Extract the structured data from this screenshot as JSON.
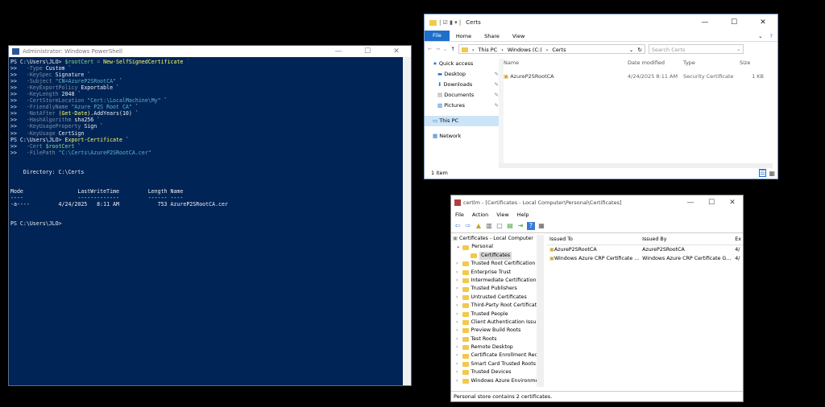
{
  "powershell": {
    "title": "Administrator: Windows PowerShell",
    "lines": [
      [
        {
          "t": "PS C:\\Users\\JLO> ",
          "c": "w"
        },
        {
          "t": "$rootCert",
          "c": "gr"
        },
        {
          "t": " = ",
          "c": "g"
        },
        {
          "t": "New-SelfSignedCertificate",
          "c": "y"
        },
        {
          "t": " `",
          "c": "g"
        }
      ],
      [
        {
          "t": ">>   ",
          "c": "w"
        },
        {
          "t": "-Type",
          "c": "g"
        },
        {
          "t": " Custom `",
          "c": "w"
        }
      ],
      [
        {
          "t": ">>   ",
          "c": "w"
        },
        {
          "t": "-KeySpec",
          "c": "g"
        },
        {
          "t": " Signature `",
          "c": "w"
        }
      ],
      [
        {
          "t": ">>   ",
          "c": "w"
        },
        {
          "t": "-Subject",
          "c": "g"
        },
        {
          "t": " \"CN=AzureP2SRootCA\"",
          "c": "c"
        },
        {
          "t": " `",
          "c": "w"
        }
      ],
      [
        {
          "t": ">>   ",
          "c": "w"
        },
        {
          "t": "-KeyExportPolicy",
          "c": "g"
        },
        {
          "t": " Exportable `",
          "c": "w"
        }
      ],
      [
        {
          "t": ">>   ",
          "c": "w"
        },
        {
          "t": "-KeyLength",
          "c": "g"
        },
        {
          "t": " 2048 `",
          "c": "w"
        }
      ],
      [
        {
          "t": ">>   ",
          "c": "w"
        },
        {
          "t": "-CertStoreLocation",
          "c": "g"
        },
        {
          "t": " \"Cert:\\LocalMachine\\My\"",
          "c": "c"
        },
        {
          "t": " `",
          "c": "w"
        }
      ],
      [
        {
          "t": ">>   ",
          "c": "w"
        },
        {
          "t": "-FriendlyName",
          "c": "g"
        },
        {
          "t": " \"Azure P2S Root CA\"",
          "c": "c"
        },
        {
          "t": " `",
          "c": "w"
        }
      ],
      [
        {
          "t": ">>   ",
          "c": "w"
        },
        {
          "t": "-NotAfter",
          "c": "g"
        },
        {
          "t": " (Get-Date)",
          "c": "y"
        },
        {
          "t": ".AddYears(10) `",
          "c": "w"
        }
      ],
      [
        {
          "t": ">>   ",
          "c": "w"
        },
        {
          "t": "-HashAlgorithm",
          "c": "g"
        },
        {
          "t": " sha256 `",
          "c": "w"
        }
      ],
      [
        {
          "t": ">>   ",
          "c": "w"
        },
        {
          "t": "-KeyUsageProperty",
          "c": "g"
        },
        {
          "t": " Sign `",
          "c": "w"
        }
      ],
      [
        {
          "t": ">>   ",
          "c": "w"
        },
        {
          "t": "-KeyUsage",
          "c": "g"
        },
        {
          "t": " CertSign",
          "c": "w"
        }
      ],
      [
        {
          "t": "PS C:\\Users\\JLO> ",
          "c": "w"
        },
        {
          "t": "Export-Certificate",
          "c": "y"
        },
        {
          "t": " `",
          "c": "w"
        }
      ],
      [
        {
          "t": ">>   ",
          "c": "w"
        },
        {
          "t": "-Cert",
          "c": "g"
        },
        {
          "t": " $rootCert",
          "c": "gr"
        },
        {
          "t": " `",
          "c": "w"
        }
      ],
      [
        {
          "t": ">>   ",
          "c": "w"
        },
        {
          "t": "-FilePath",
          "c": "g"
        },
        {
          "t": " \"C:\\Certs\\AzureP2SRootCA.cer\"",
          "c": "c"
        }
      ],
      [
        {
          "t": "",
          "c": "w"
        }
      ],
      [
        {
          "t": "",
          "c": "w"
        }
      ],
      [
        {
          "t": "    Directory: C:\\Certs",
          "c": "w"
        }
      ],
      [
        {
          "t": "",
          "c": "w"
        }
      ],
      [
        {
          "t": "",
          "c": "w"
        }
      ],
      [
        {
          "t": "Mode                 LastWriteTime         Length Name",
          "c": "w"
        }
      ],
      [
        {
          "t": "----                 -------------         ------ ----",
          "c": "w"
        }
      ],
      [
        {
          "t": "-a----         4/24/2025   8:11 AM            753 AzureP2SRootCA.cer",
          "c": "w"
        }
      ],
      [
        {
          "t": "",
          "c": "w"
        }
      ],
      [
        {
          "t": "",
          "c": "w"
        }
      ],
      [
        {
          "t": "PS C:\\Users\\JLO>",
          "c": "w"
        }
      ]
    ]
  },
  "explorer": {
    "title": "Certs",
    "ribbon": [
      "File",
      "Home",
      "Share",
      "View"
    ],
    "breadcrumb": [
      "This PC",
      "Windows (C:)",
      "Certs"
    ],
    "search_placeholder": "Search Certs",
    "nav": {
      "quick_access": "Quick access",
      "items": [
        "Desktop",
        "Downloads",
        "Documents",
        "Pictures"
      ],
      "this_pc": "This PC",
      "network": "Network"
    },
    "columns": [
      "Name",
      "Date modified",
      "Type",
      "Size"
    ],
    "files": [
      {
        "name": "AzureP2SRootCA",
        "date": "4/24/2025 8:11 AM",
        "type": "Security Certificate",
        "size": "1 KB"
      }
    ],
    "status": "1 item"
  },
  "certlm": {
    "title": "certlm - [Certificates - Local Computer\\Personal\\Certificates]",
    "menu": [
      "File",
      "Action",
      "View",
      "Help"
    ],
    "tree": {
      "root": "Certificates - Local Computer",
      "personal": "Personal",
      "certificates": "Certificates",
      "folders": [
        "Trusted Root Certification",
        "Enterprise Trust",
        "Intermediate Certification",
        "Trusted Publishers",
        "Untrusted Certificates",
        "Third-Party Root Certificat",
        "Trusted People",
        "Client Authentication Issu",
        "Preview Build Roots",
        "Test Roots",
        "Remote Desktop",
        "Certificate Enrollment Rec",
        "Smart Card Trusted Roots",
        "Trusted Devices",
        "Windows Azure Environme"
      ]
    },
    "columns": [
      "Issued To",
      "Issued By",
      "Ex"
    ],
    "rows": [
      {
        "to": "AzureP2SRootCA",
        "by": "AzureP2SRootCA",
        "ex": "4/"
      },
      {
        "to": "Windows Azure CRP Certificate ...",
        "by": "Windows Azure CRP Certificate G...",
        "ex": "4/"
      }
    ],
    "status": "Personal store contains 2 certificates."
  }
}
